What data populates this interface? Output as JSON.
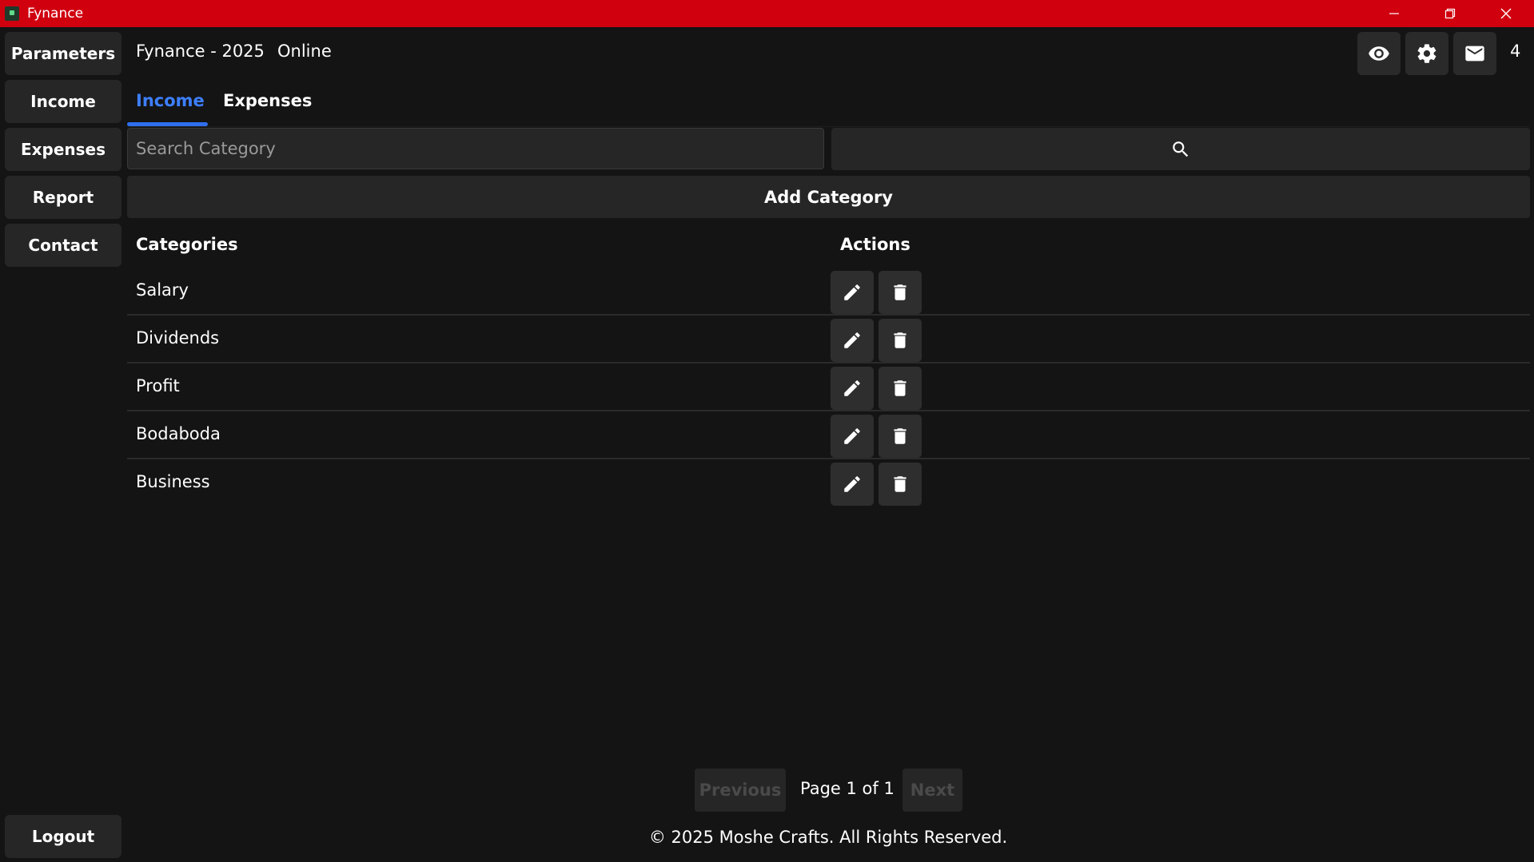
{
  "window": {
    "title": "Fynance"
  },
  "sidebar": {
    "items": [
      {
        "label": "Parameters"
      },
      {
        "label": "Income"
      },
      {
        "label": "Expenses"
      },
      {
        "label": "Report"
      },
      {
        "label": "Contact"
      }
    ],
    "logout_label": "Logout"
  },
  "header": {
    "title": "Fynance - 2025",
    "status": "Online",
    "icons": [
      "eye-icon",
      "gear-icon",
      "mail-icon"
    ],
    "message_count": "4"
  },
  "tabs": [
    {
      "label": "Income",
      "active": true
    },
    {
      "label": "Expenses",
      "active": false
    }
  ],
  "search": {
    "placeholder": "Search Category",
    "value": ""
  },
  "add_button_label": "Add Category",
  "table": {
    "headers": {
      "categories": "Categories",
      "actions": "Actions"
    },
    "rows": [
      "Salary",
      "Dividends",
      "Profit",
      "Bodaboda",
      "Business"
    ]
  },
  "pagination": {
    "previous": "Previous",
    "info": "Page 1 of 1",
    "next": "Next"
  },
  "footer": "© 2025 Moshe Crafts. All Rights Reserved.",
  "colors": {
    "titlebar": "#d0000f",
    "accent": "#2f6fed",
    "background": "#141414",
    "button": "#262626"
  }
}
